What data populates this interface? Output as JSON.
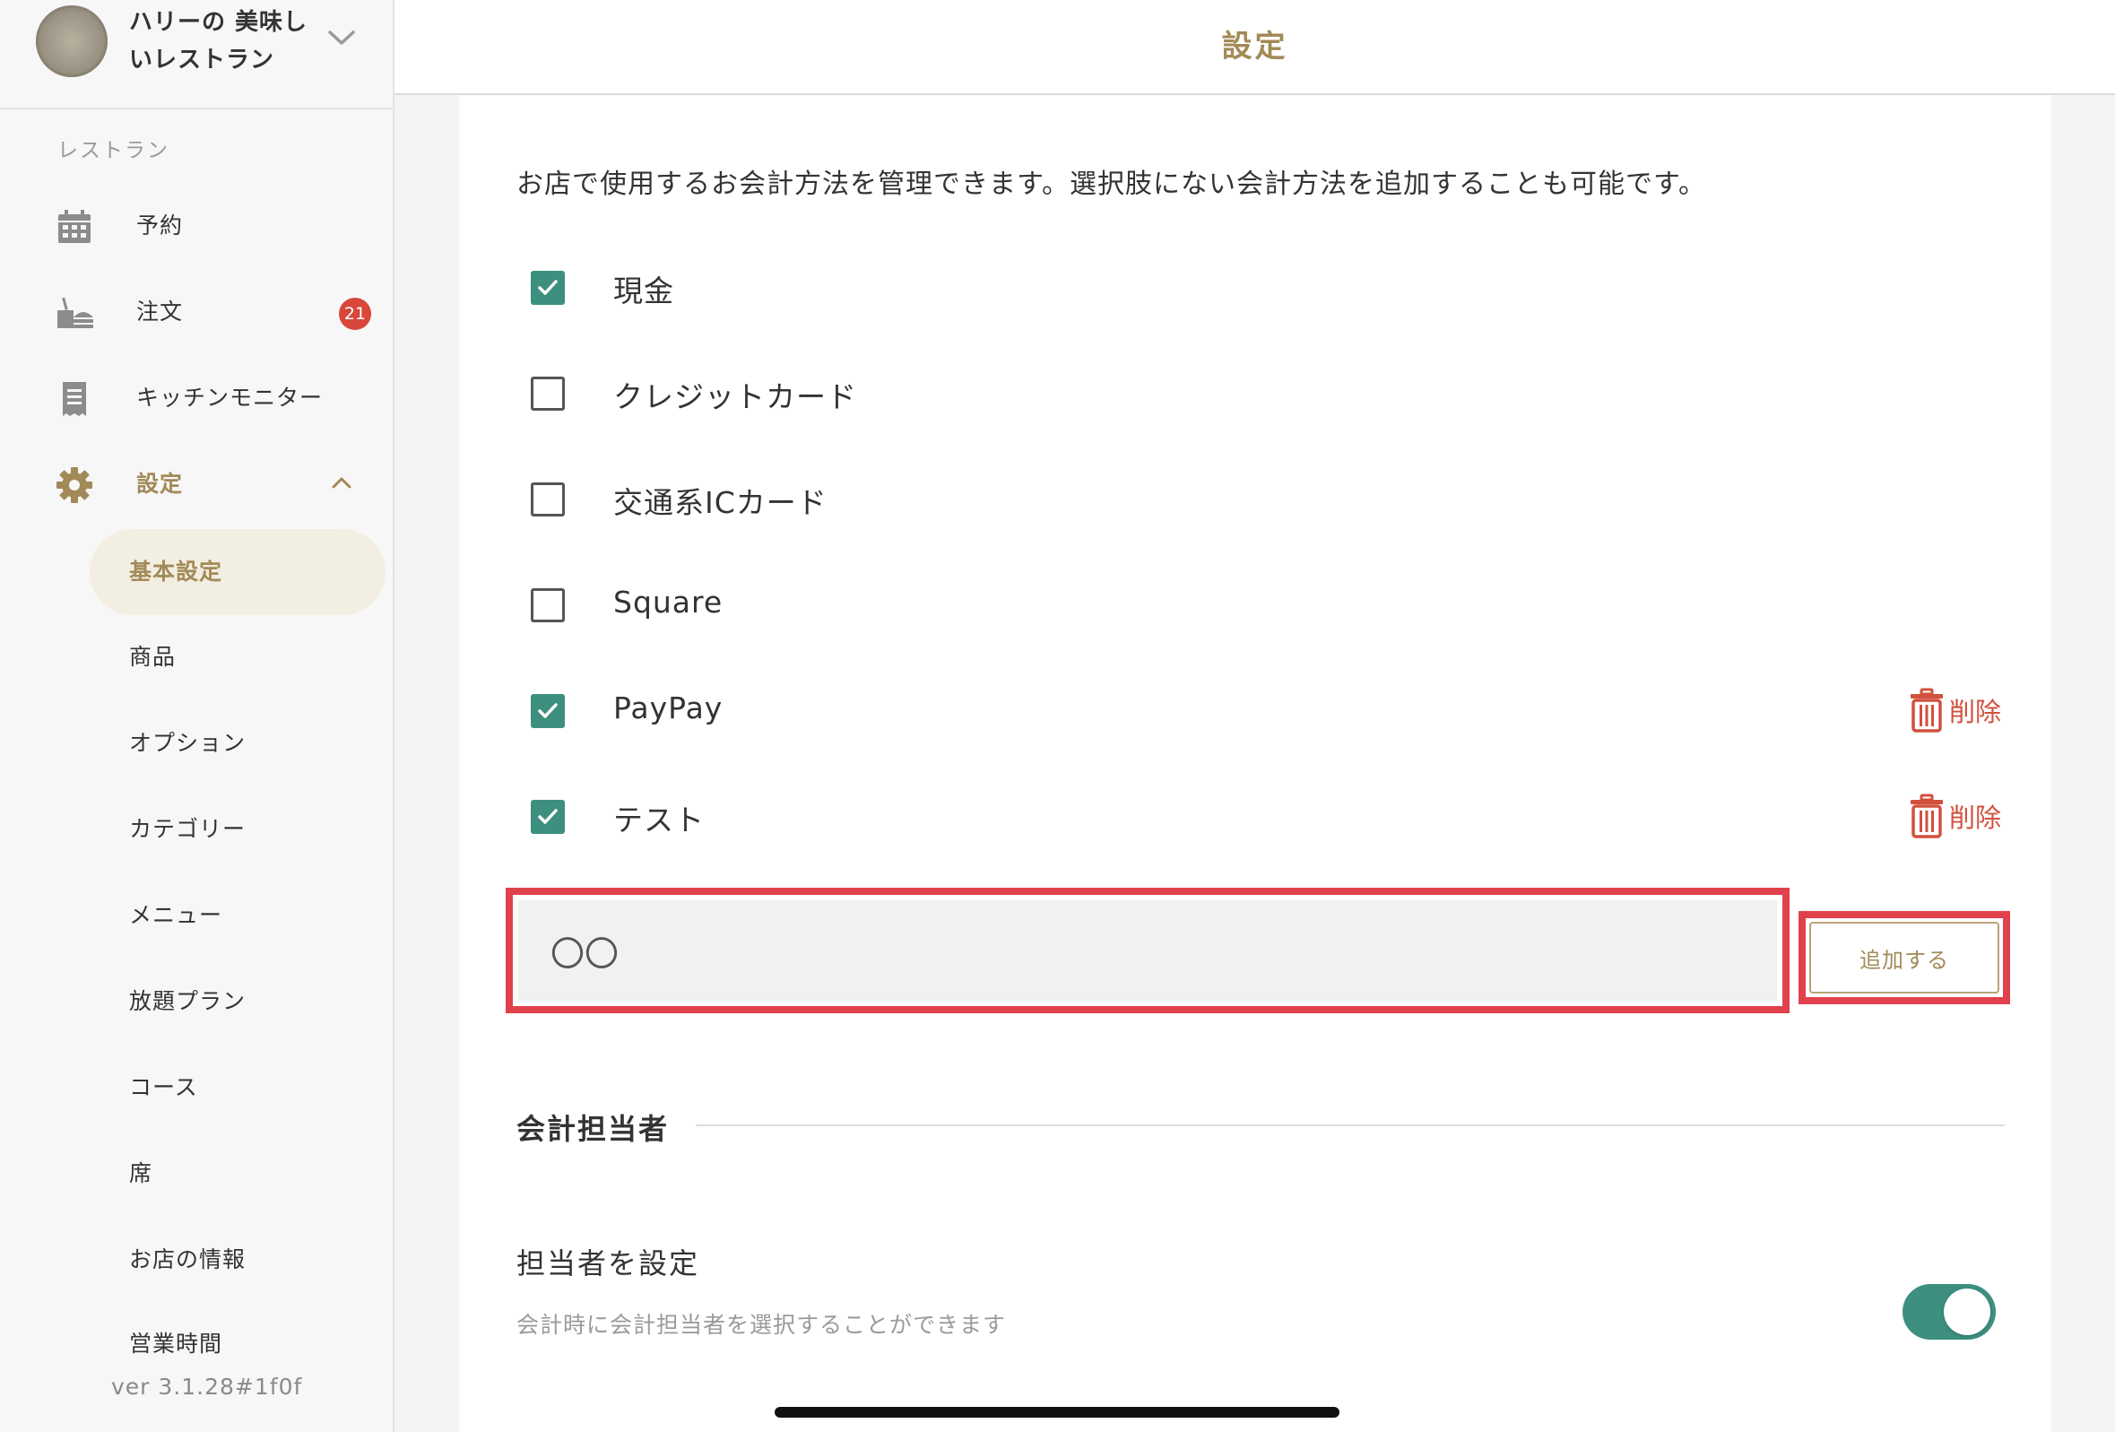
{
  "sidebar": {
    "store_name": "ハリーの 美味しいレストラン",
    "section_label": "レストラン",
    "nav": [
      {
        "label": "予約",
        "icon": "calendar-icon"
      },
      {
        "label": "注文",
        "icon": "orders-icon",
        "badge": "21"
      },
      {
        "label": "キッチンモニター",
        "icon": "receipt-icon"
      },
      {
        "label": "設定",
        "icon": "gear-icon",
        "expanded": true
      }
    ],
    "sub_items": [
      {
        "label": "基本設定",
        "selected": true
      },
      {
        "label": "商品"
      },
      {
        "label": "オプション"
      },
      {
        "label": "カテゴリー"
      },
      {
        "label": "メニュー"
      },
      {
        "label": "放題プラン"
      },
      {
        "label": "コース"
      },
      {
        "label": "席"
      },
      {
        "label": "お店の情報"
      },
      {
        "label": "営業時間"
      }
    ],
    "version": "ver 3.1.28#1f0f"
  },
  "header": {
    "title": "設定"
  },
  "payment": {
    "intro": "お店で使用するお会計方法を管理できます。選択肢にない会計方法を追加することも可能です。",
    "methods": [
      {
        "label": "現金",
        "checked": true,
        "deletable": false
      },
      {
        "label": "クレジットカード",
        "checked": false,
        "deletable": false
      },
      {
        "label": "交通系ICカード",
        "checked": false,
        "deletable": false
      },
      {
        "label": "Square",
        "checked": false,
        "deletable": false
      },
      {
        "label": "PayPay",
        "checked": true,
        "deletable": true
      },
      {
        "label": "テスト",
        "checked": true,
        "deletable": true
      }
    ],
    "delete_label": "削除",
    "new_method_value": "〇〇",
    "add_button_label": "追加する"
  },
  "accountant": {
    "section_title": "会計担当者",
    "setting_title": "担当者を設定",
    "setting_description": "会計時に会計担当者を選択することができます",
    "toggle_on": true
  },
  "colors": {
    "accent_gold": "#a28a58",
    "check_green": "#3d8f7f",
    "badge_red": "#d9463a",
    "delete_red": "#d2503d",
    "highlight_red": "#e0424d"
  }
}
